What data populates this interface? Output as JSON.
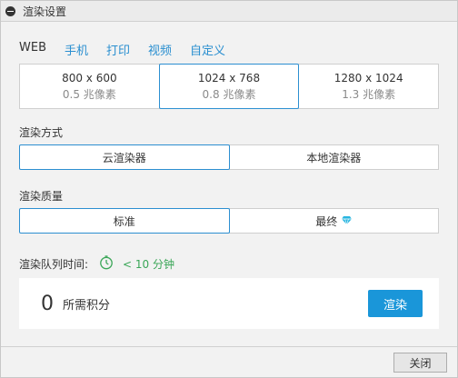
{
  "window": {
    "title": "渲染设置"
  },
  "tabs": [
    {
      "label": "WEB",
      "active": true
    },
    {
      "label": "手机",
      "active": false
    },
    {
      "label": "打印",
      "active": false
    },
    {
      "label": "视频",
      "active": false
    },
    {
      "label": "自定义",
      "active": false
    }
  ],
  "resolutions": [
    {
      "size": "800 x 600",
      "megapixels": "0.5 兆像素",
      "selected": false
    },
    {
      "size": "1024 x 768",
      "megapixels": "0.8 兆像素",
      "selected": true
    },
    {
      "size": "1280 x 1024",
      "megapixels": "1.3 兆像素",
      "selected": false
    }
  ],
  "render_method": {
    "label": "渲染方式",
    "options": [
      {
        "label": "云渲染器",
        "selected": true
      },
      {
        "label": "本地渲染器",
        "selected": false
      }
    ]
  },
  "render_quality": {
    "label": "渲染质量",
    "options": [
      {
        "label": "标准",
        "selected": true,
        "icon": null
      },
      {
        "label": "最终",
        "selected": false,
        "icon": "diamond-icon"
      }
    ]
  },
  "queue": {
    "label": "渲染队列时间:",
    "icon": "timer-icon",
    "time": "< 10 分钟"
  },
  "credits": {
    "value": "0",
    "label": "所需积分",
    "render_button": "渲染"
  },
  "footer": {
    "close_button": "关闭"
  },
  "colors": {
    "accent": "#2c8fd1",
    "button": "#1a96d9",
    "green": "#3aa657",
    "gem": "#29b6e0"
  }
}
